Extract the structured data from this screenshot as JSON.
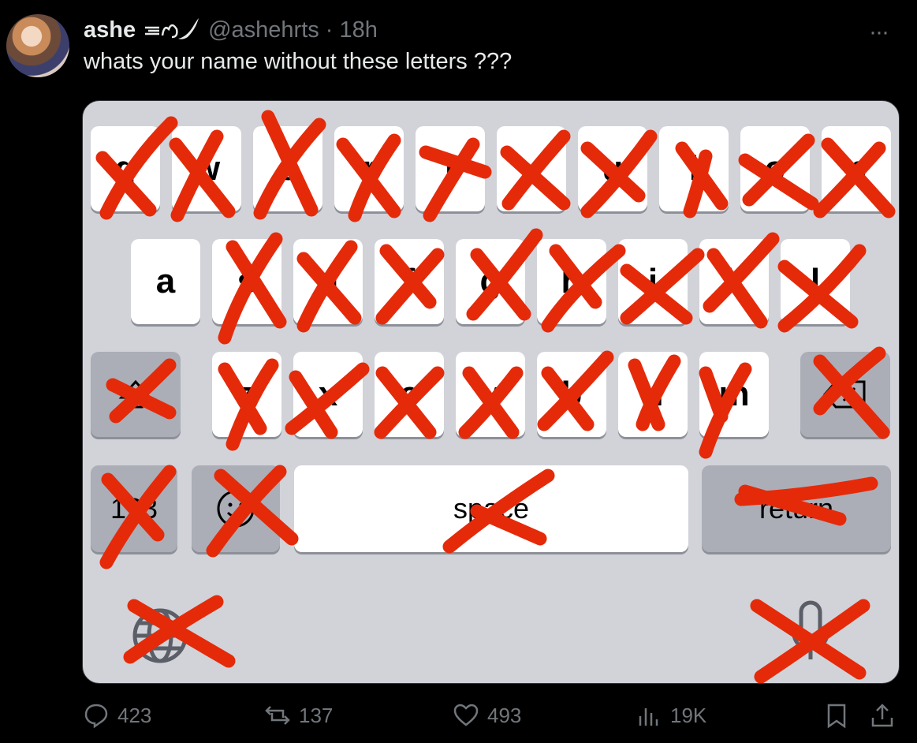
{
  "tweet": {
    "display_name": "ashe",
    "handle": "@ashehrts",
    "separator": "·",
    "time": "18h",
    "text": "whats your name without these letters ???",
    "more": "···"
  },
  "keyboard": {
    "row1": [
      "q",
      "w",
      "e",
      "r",
      "t",
      "y",
      "u",
      "i",
      "o",
      "p"
    ],
    "row2": [
      "a",
      "s",
      "d",
      "f",
      "g",
      "h",
      "j",
      "k",
      "l"
    ],
    "row3": [
      "z",
      "x",
      "c",
      "v",
      "b",
      "n",
      "m"
    ],
    "number_key": "123",
    "space_label": "space",
    "return_label": "return",
    "crossed_out": [
      "q",
      "w",
      "e",
      "r",
      "t",
      "y",
      "u",
      "i",
      "o",
      "p",
      "s",
      "d",
      "f",
      "g",
      "h",
      "j",
      "k",
      "l",
      "z",
      "x",
      "c",
      "v",
      "b",
      "n",
      "m",
      "shift",
      "delete",
      "123",
      "emoji",
      "space",
      "return",
      "globe",
      "mic"
    ],
    "visible_letters": [
      "a",
      "s",
      "d",
      "f",
      "g",
      "h",
      "j",
      "k",
      "l",
      "z",
      "x",
      "c",
      "v",
      "b",
      "n",
      "m"
    ],
    "cross_color": "#e52a0a"
  },
  "actions": {
    "replies": "423",
    "reposts": "137",
    "likes": "493",
    "views": "19K"
  }
}
